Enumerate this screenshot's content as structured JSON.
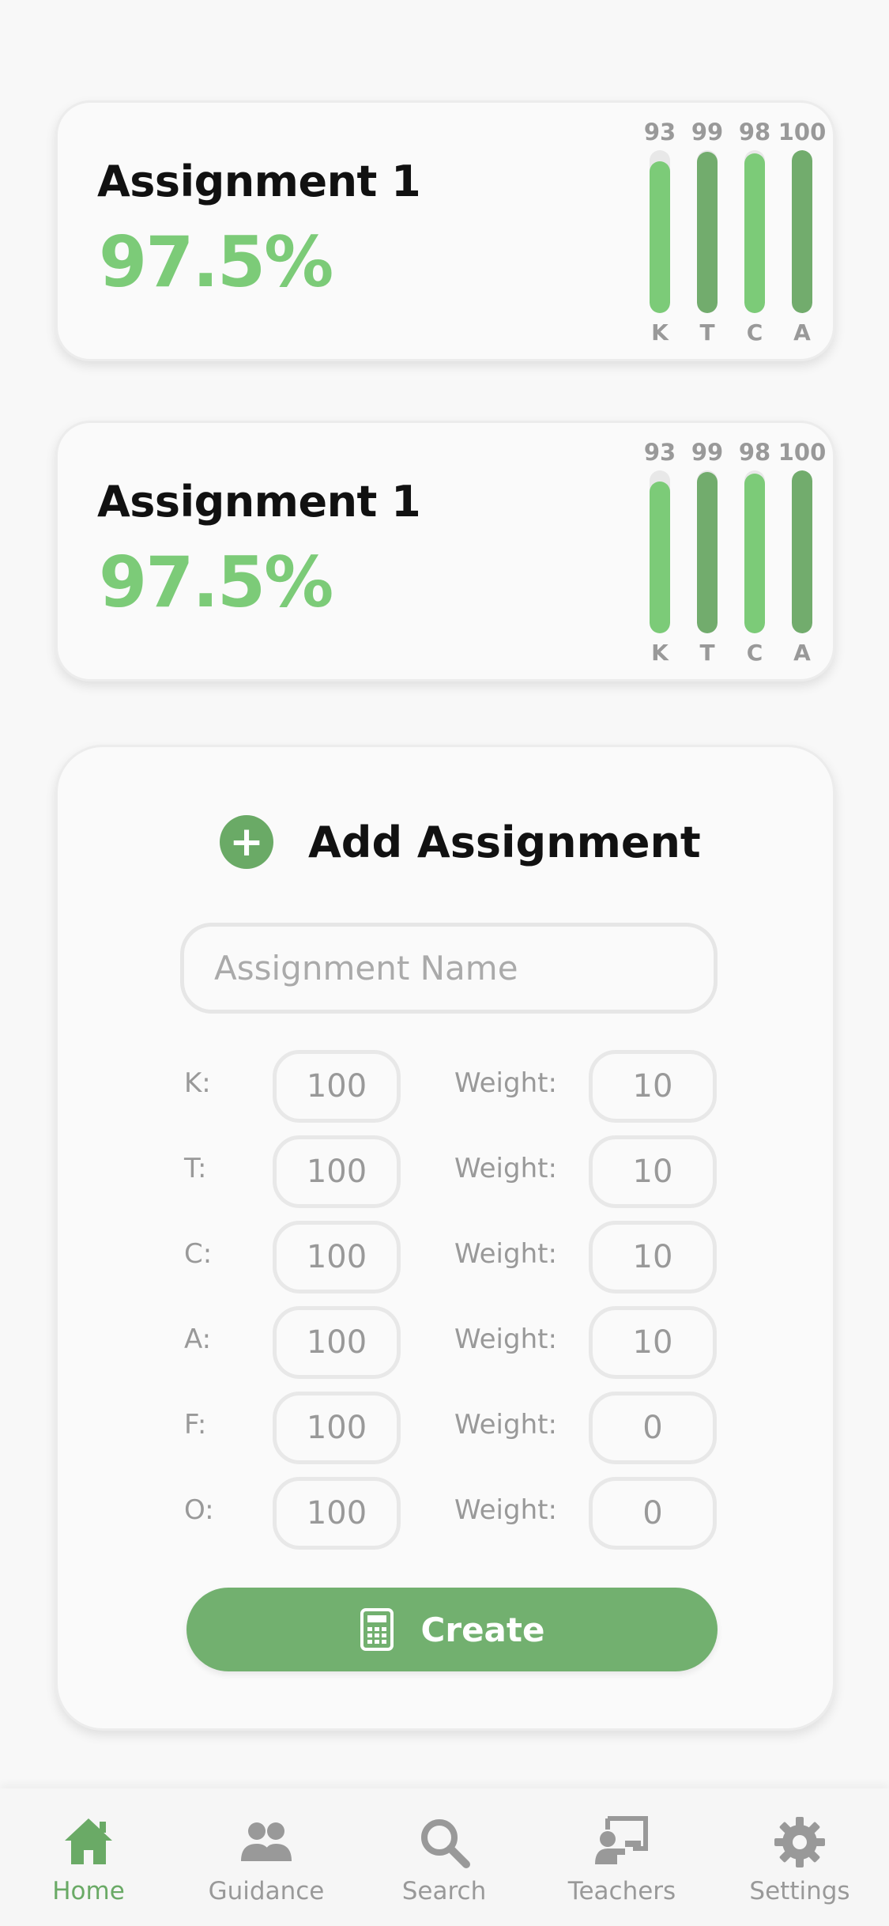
{
  "assignments": [
    {
      "title": "Assignment 1",
      "score": "97.5%",
      "bars": [
        {
          "label": "K",
          "value": 93,
          "display": "93",
          "color": "#7ccb78"
        },
        {
          "label": "T",
          "value": 99,
          "display": "99",
          "color": "#72ac6d"
        },
        {
          "label": "C",
          "value": 98,
          "display": "98",
          "color": "#7ccb78"
        },
        {
          "label": "A",
          "value": 100,
          "display": "100",
          "color": "#72ac6d"
        }
      ]
    },
    {
      "title": "Assignment 1",
      "score": "97.5%",
      "bars": [
        {
          "label": "K",
          "value": 93,
          "display": "93",
          "color": "#7ccb78"
        },
        {
          "label": "T",
          "value": 99,
          "display": "99",
          "color": "#72ac6d"
        },
        {
          "label": "C",
          "value": 98,
          "display": "98",
          "color": "#7ccb78"
        },
        {
          "label": "A",
          "value": 100,
          "display": "100",
          "color": "#72ac6d"
        }
      ]
    }
  ],
  "add_form": {
    "title": "Add Assignment",
    "plus_icon": "+",
    "name_placeholder": "Assignment Name",
    "weight_label": "Weight:",
    "rows": [
      {
        "label": "K:",
        "score": "100",
        "weight": "10"
      },
      {
        "label": "T:",
        "score": "100",
        "weight": "10"
      },
      {
        "label": "C:",
        "score": "100",
        "weight": "10"
      },
      {
        "label": "A:",
        "score": "100",
        "weight": "10"
      },
      {
        "label": "F:",
        "score": "100",
        "weight": "0"
      },
      {
        "label": "O:",
        "score": "100",
        "weight": "0"
      }
    ],
    "create_label": "Create",
    "create_icon": "calculator-icon"
  },
  "tabbar": {
    "items": [
      {
        "label": "Home",
        "icon": "home-icon",
        "active": true
      },
      {
        "label": "Guidance",
        "icon": "users-icon",
        "active": false
      },
      {
        "label": "Search",
        "icon": "search-icon",
        "active": false
      },
      {
        "label": "Teachers",
        "icon": "teacher-board-icon",
        "active": false
      },
      {
        "label": "Settings",
        "icon": "gear-icon",
        "active": false
      }
    ]
  },
  "colors": {
    "accent": "#6aaa66",
    "score_green": "#7ccb78",
    "bar_dark": "#72ac6d",
    "muted": "#999999"
  }
}
